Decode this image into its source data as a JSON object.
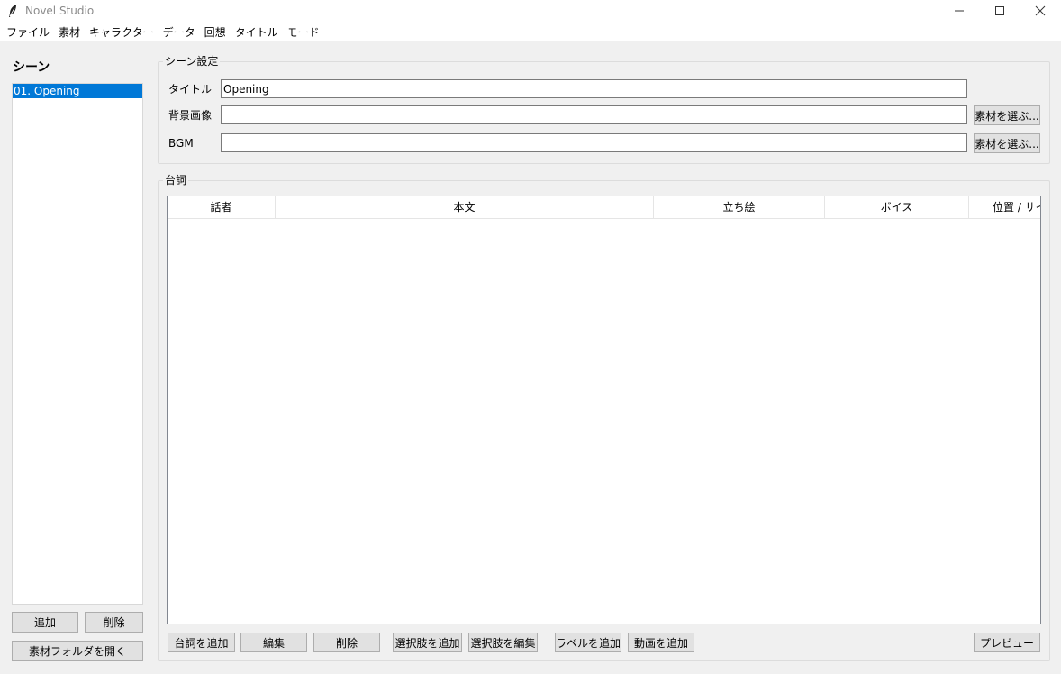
{
  "window": {
    "title": "Novel Studio",
    "icon": "quill-feather-icon"
  },
  "menu": [
    {
      "label": "ファイル"
    },
    {
      "label": "素材"
    },
    {
      "label": "キャラクター"
    },
    {
      "label": "データ"
    },
    {
      "label": "回想"
    },
    {
      "label": "タイトル"
    },
    {
      "label": "モード"
    }
  ],
  "sidebar": {
    "heading": "シーン",
    "scenes": [
      "01. Opening"
    ],
    "selected_index": 0,
    "add_label": "追加",
    "delete_label": "削除",
    "open_folder_label": "素材フォルダを開く"
  },
  "scene_settings": {
    "group_label": "シーン設定",
    "title_label": "タイトル",
    "title_value": "Opening",
    "background_label": "背景画像",
    "background_value": "",
    "background_button": "素材を選ぶ...",
    "bgm_label": "BGM",
    "bgm_value": "",
    "bgm_button": "素材を選ぶ..."
  },
  "dialogue": {
    "group_label": "台詞",
    "columns": [
      "話者",
      "本文",
      "立ち絵",
      "ボイス",
      "位置 / サイ"
    ],
    "rows": [],
    "buttons": {
      "add": "台詞を追加",
      "edit": "編集",
      "delete": "削除",
      "add_choice": "選択肢を追加",
      "edit_choice": "選択肢を編集",
      "add_label": "ラベルを追加",
      "add_video": "動画を追加",
      "preview": "プレビュー"
    }
  },
  "colors": {
    "selection": "#0078d7",
    "window_bg": "#f0f0f0",
    "button_bg": "#e1e1e1"
  }
}
